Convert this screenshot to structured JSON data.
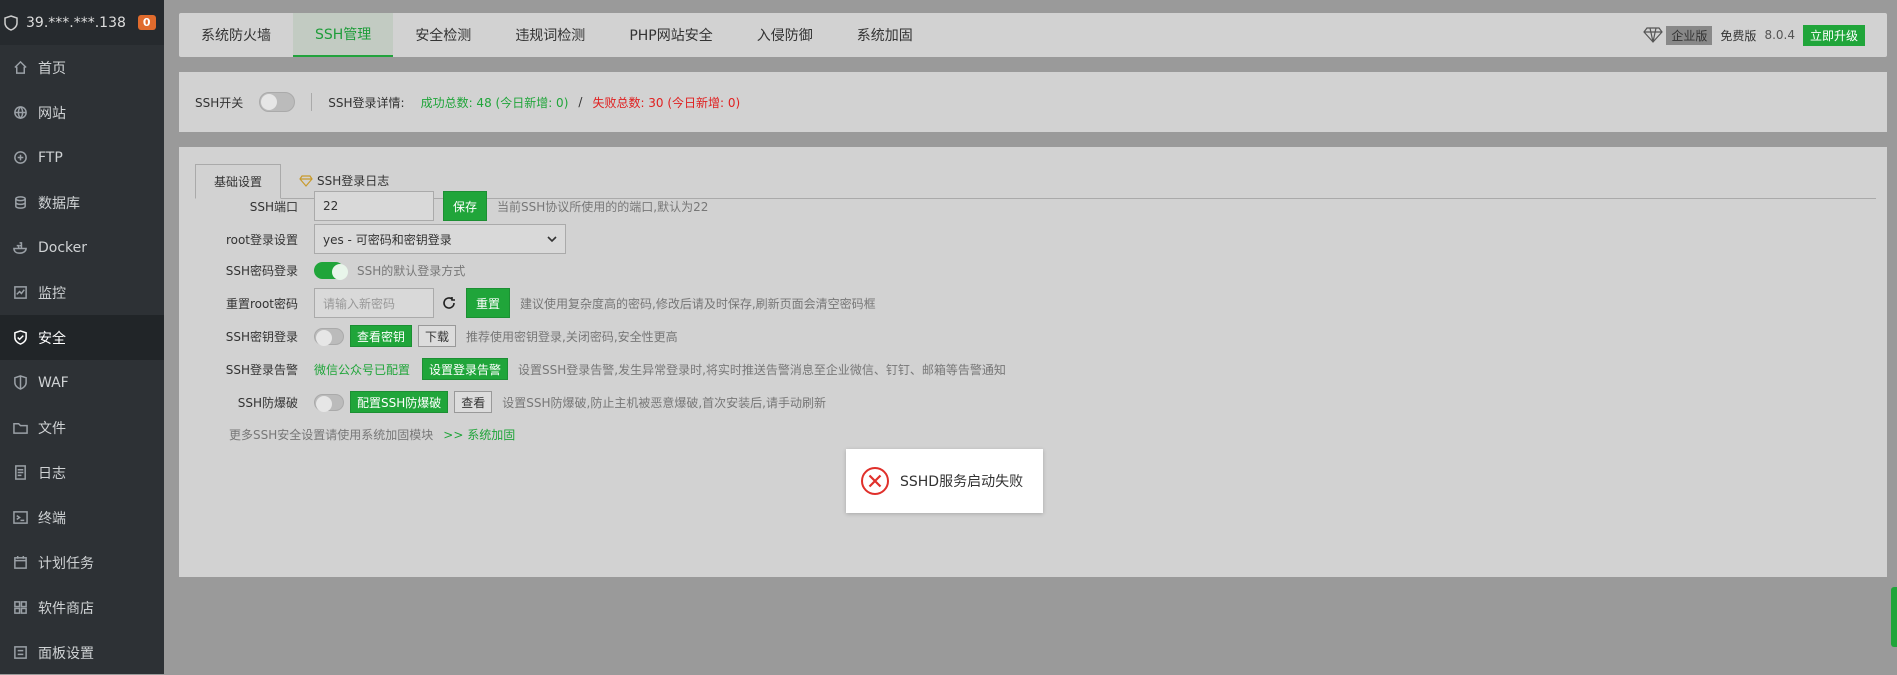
{
  "sidebar": {
    "server": "39.***.***.138",
    "badge": "0",
    "items": [
      {
        "label": "首页",
        "icon": "home-icon"
      },
      {
        "label": "网站",
        "icon": "globe-icon"
      },
      {
        "label": "FTP",
        "icon": "ftp-icon"
      },
      {
        "label": "数据库",
        "icon": "database-icon"
      },
      {
        "label": "Docker",
        "icon": "docker-icon"
      },
      {
        "label": "监控",
        "icon": "monitor-icon"
      },
      {
        "label": "安全",
        "icon": "shield-icon"
      },
      {
        "label": "WAF",
        "icon": "waf-icon"
      },
      {
        "label": "文件",
        "icon": "folder-icon"
      },
      {
        "label": "日志",
        "icon": "log-icon"
      },
      {
        "label": "终端",
        "icon": "terminal-icon"
      },
      {
        "label": "计划任务",
        "icon": "calendar-icon"
      },
      {
        "label": "软件商店",
        "icon": "apps-icon"
      },
      {
        "label": "面板设置",
        "icon": "settings-icon"
      }
    ]
  },
  "tabs": [
    "系统防火墙",
    "SSH管理",
    "安全检测",
    "违规词检测",
    "PHP网站安全",
    "入侵防御",
    "系统加固"
  ],
  "topright": {
    "edition": "企业版",
    "free_trial": "免费版",
    "version": "8.0.4",
    "upgrade": "立即升级"
  },
  "stat": {
    "switch_label": "SSH开关",
    "detail_label": "SSH登录详情:",
    "success": "成功总数: 48 (今日新增: 0)",
    "slash": "/",
    "fail": "失败总数: 30 (今日新增: 0)"
  },
  "panel_tabs": [
    "基础设置",
    "SSH登录日志"
  ],
  "form": {
    "port_label": "SSH端口",
    "port_value": "22",
    "save": "保存",
    "port_hint": "当前SSH协议所使用的的端口,默认为22",
    "root_label": "root登录设置",
    "root_value": "yes - 可密码和密钥登录",
    "pwd_label": "SSH密码登录",
    "pwd_hint": "SSH的默认登录方式",
    "reset_label": "重置root密码",
    "reset_placeholder": "请输入新密码",
    "reset_btn": "重置",
    "reset_hint": "建议使用复杂度高的密码,修改后请及时保存,刷新页面会清空密码框",
    "key_label": "SSH密钥登录",
    "view_key": "查看密钥",
    "download": "下载",
    "key_hint": "推荐使用密钥登录,关闭密码,安全性更高",
    "alarm_label": "SSH登录告警",
    "alarm_status": "微信公众号已配置",
    "alarm_btn": "设置登录告警",
    "alarm_hint": "设置SSH登录告警,发生异常登录时,将实时推送告警消息至企业微信、钉钉、邮箱等告警通知",
    "brute_label": "SSH防爆破",
    "brute_btn": "配置SSH防爆破",
    "brute_view": "查看",
    "brute_hint": "设置SSH防爆破,防止主机被恶意爆破,首次安装后,请手动刷新",
    "more_text": "更多SSH安全设置请使用系统加固模块",
    "more_link": ">> 系统加固"
  },
  "toast": {
    "message": "SSHD服务启动失败"
  }
}
